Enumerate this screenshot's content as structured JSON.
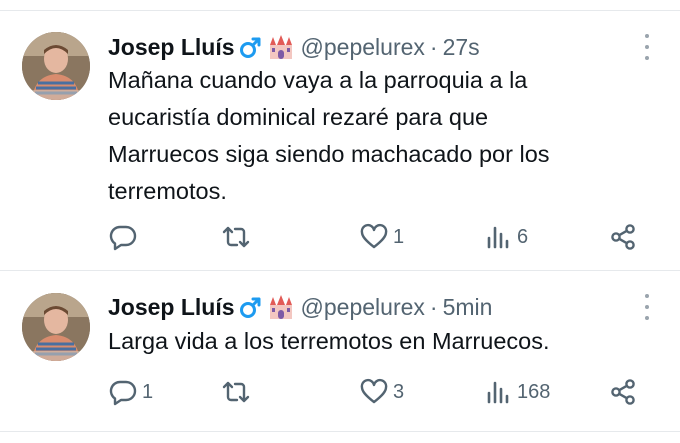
{
  "colors": {
    "text": "#0f1419",
    "secondary": "#536471",
    "divider": "#e6e9ec",
    "male_sign": "#1d9bf0"
  },
  "tweets": [
    {
      "author_name": "Josep Lluís",
      "author_handle": "@pepelurex",
      "separator": "·",
      "time": "27s",
      "icons": [
        "male-sign-icon",
        "castle-icon"
      ],
      "text_lines": [
        "Mañana cuando vaya a la parroquia a la",
        "eucaristía dominical  rezaré para que",
        "Marruecos siga siendo machacado por los",
        "terremotos."
      ],
      "replies": "",
      "retweets": "",
      "likes": "1",
      "views": "6"
    },
    {
      "author_name": "Josep Lluís",
      "author_handle": "@pepelurex",
      "separator": "·",
      "time": "5min",
      "icons": [
        "male-sign-icon",
        "castle-icon"
      ],
      "text_lines": [
        "Larga vida a los terremotos en Marruecos."
      ],
      "replies": "1",
      "retweets": "",
      "likes": "3",
      "views": "168"
    }
  ]
}
